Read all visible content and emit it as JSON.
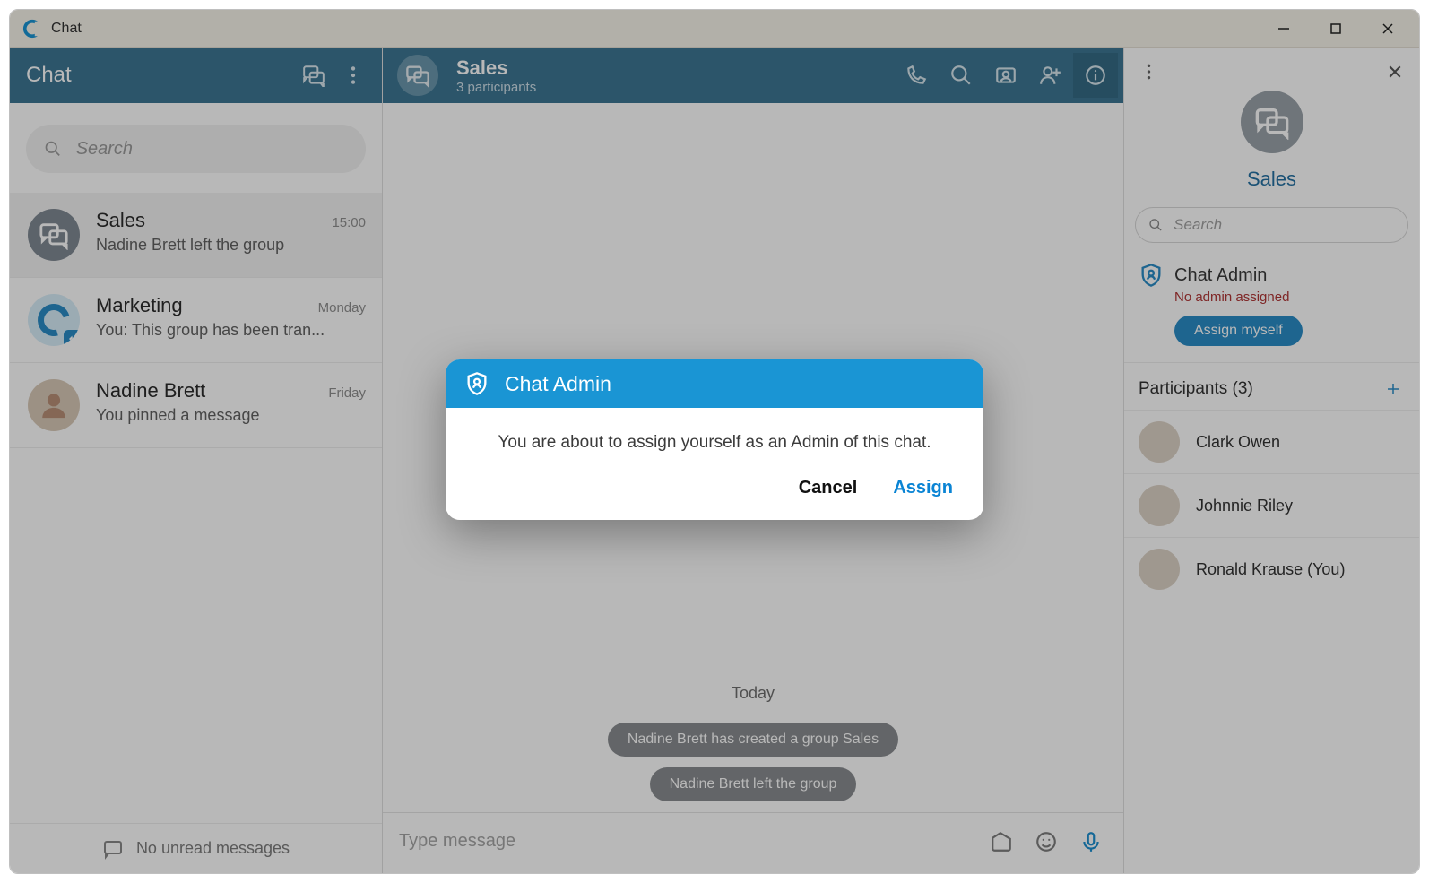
{
  "window": {
    "title": "Chat"
  },
  "sidebar": {
    "title": "Chat",
    "search_placeholder": "Search",
    "items": [
      {
        "name": "Sales",
        "time": "15:00",
        "preview": "Nadine Brett left the group",
        "type": "group",
        "active": true
      },
      {
        "name": "Marketing",
        "time": "Monday",
        "preview": "You: This group has been tran...",
        "type": "brand",
        "active": false
      },
      {
        "name": "Nadine Brett",
        "time": "Friday",
        "preview": "You pinned a message",
        "type": "person",
        "active": false
      }
    ],
    "footer_text": "No unread messages"
  },
  "main": {
    "title": "Sales",
    "subtitle": "3 participants",
    "day_divider": "Today",
    "system_messages": [
      "Nadine Brett has created a group Sales",
      "Nadine Brett left the group"
    ],
    "composer_placeholder": "Type message"
  },
  "info": {
    "name": "Sales",
    "search_placeholder": "Search",
    "admin_label": "Chat Admin",
    "admin_status": "No admin assigned",
    "assign_label": "Assign myself",
    "participants_label": "Participants (3)",
    "participants": [
      {
        "name": "Clark Owen"
      },
      {
        "name": "Johnnie Riley"
      },
      {
        "name": "Ronald Krause (You)"
      }
    ]
  },
  "dialog": {
    "title": "Chat Admin",
    "body": "You are about to assign yourself as an Admin of this chat.",
    "cancel": "Cancel",
    "assign": "Assign"
  }
}
